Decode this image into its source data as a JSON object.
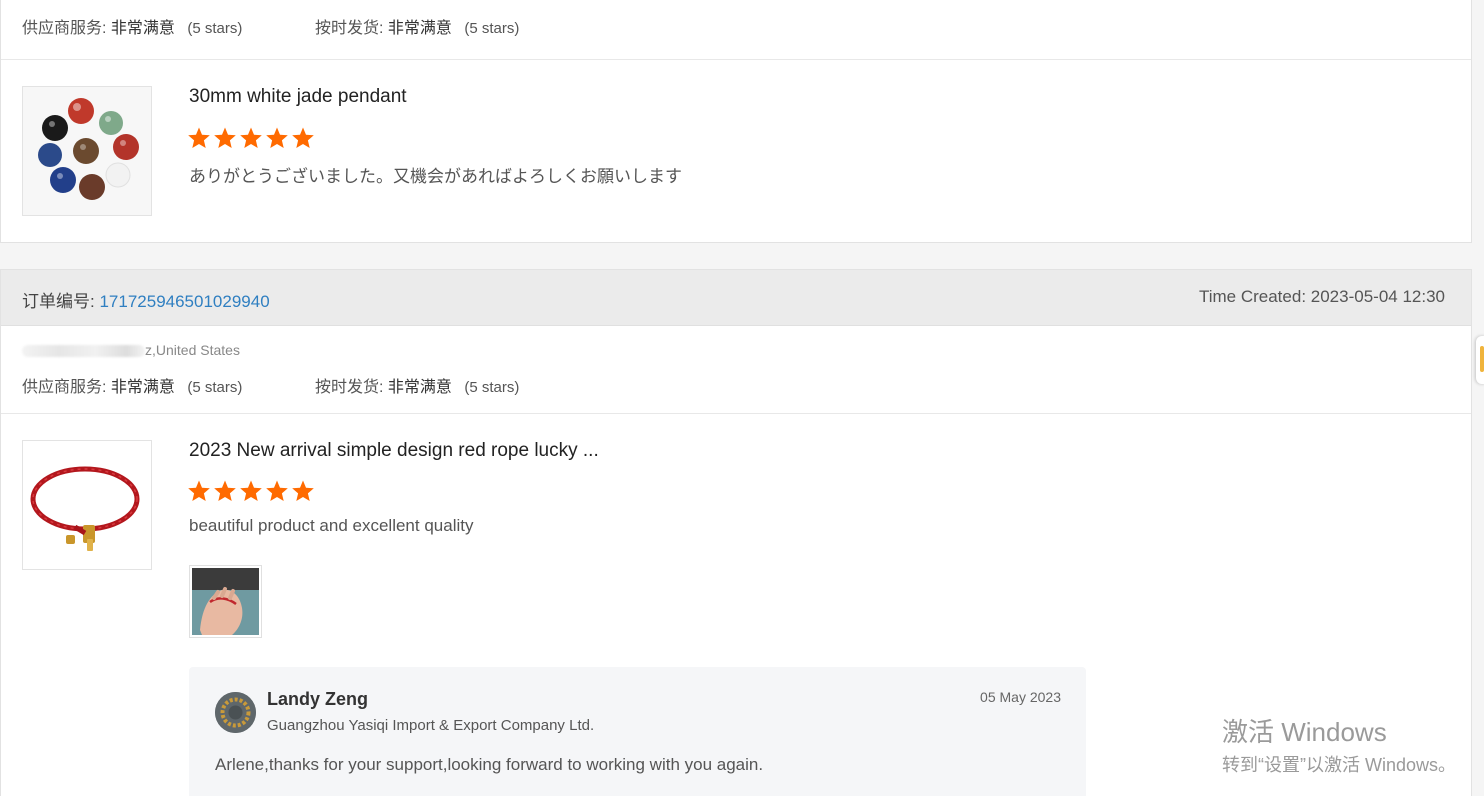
{
  "review_1": {
    "ratings": {
      "supplier_label": "供应商服务:",
      "supplier_value": "非常满意",
      "supplier_stars": "(5 stars)",
      "shipping_label": "按时发货:",
      "shipping_value": "非常满意",
      "shipping_stars": "(5 stars)"
    },
    "product_title": "30mm white jade pendant",
    "star_rating": 5,
    "comment": "ありがとうございました。又機会があればよろしくお願いします"
  },
  "review_2": {
    "order_label": "订单编号:",
    "order_number": "171725946501029940",
    "time_created": "Time Created: 2023-05-04 12:30",
    "buyer_location": "z,United States",
    "ratings": {
      "supplier_label": "供应商服务:",
      "supplier_value": "非常满意",
      "supplier_stars": "(5 stars)",
      "shipping_label": "按时发货:",
      "shipping_value": "非常满意",
      "shipping_stars": "(5 stars)"
    },
    "product_title": "2023 New arrival simple design red rope lucky ...",
    "star_rating": 5,
    "comment": "beautiful product and excellent quality",
    "reply": {
      "name": "Landy Zeng",
      "company": "Guangzhou Yasiqi Import & Export Company Ltd.",
      "date": "05 May 2023",
      "text": "Arlene,thanks for your support,looking forward to working with you again."
    }
  },
  "watermark": {
    "title": "激活 Windows",
    "subtitle": "转到“设置”以激活 Windows。"
  },
  "colors": {
    "star": "#ff6a00",
    "link": "#2f7fc1",
    "header_bg": "#ebebeb"
  },
  "icons": {
    "star": "star-icon",
    "avatar": "avatar"
  }
}
